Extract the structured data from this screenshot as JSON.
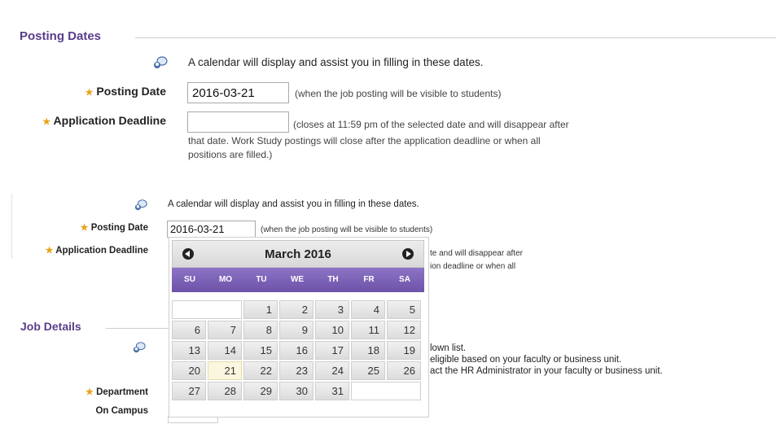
{
  "section1": {
    "title": "Posting Dates",
    "help_text": "A calendar will display and assist you in filling in these dates.",
    "posting_date_label": "Posting Date",
    "posting_date_value": "2016-03-21",
    "posting_date_hint": "(when the job posting will be visible to students)",
    "deadline_label": "Application Deadline",
    "deadline_value": "",
    "deadline_hint_line1": "(closes at 11:59 pm of the selected date and will disappear after",
    "deadline_hint_line2": "that date. Work Study postings will close after the application deadline or when all",
    "deadline_hint_line3": "positions are filled.)"
  },
  "section2": {
    "help_text": "A calendar will display and assist you in filling in these dates.",
    "posting_date_label": "Posting Date",
    "posting_date_value": "2016-03-21",
    "posting_date_hint": "(when the job posting will be visible to students)",
    "deadline_label": "Application Deadline",
    "deadline_hint_frag1": "te and will disappear after",
    "deadline_hint_frag2": "ion deadline or when all"
  },
  "job_details": {
    "title": "Job Details",
    "info_frag1": "lown list.",
    "info_frag2": "eligible based on your faculty or business unit.",
    "info_frag3": "act the HR Administrator in your faculty or business unit.",
    "department_label": "Department",
    "on_campus_label": "On Campus"
  },
  "datepicker": {
    "title": "March 2016",
    "weekdays": [
      "SU",
      "MO",
      "TU",
      "WE",
      "TH",
      "FR",
      "SA"
    ],
    "selected_day": 21,
    "weeks": [
      [
        "",
        "",
        "1",
        "2",
        "3",
        "4",
        "5"
      ],
      [
        "6",
        "7",
        "8",
        "9",
        "10",
        "11",
        "12"
      ],
      [
        "13",
        "14",
        "15",
        "16",
        "17",
        "18",
        "19"
      ],
      [
        "20",
        "21",
        "22",
        "23",
        "24",
        "25",
        "26"
      ],
      [
        "27",
        "28",
        "29",
        "30",
        "31",
        "",
        ""
      ]
    ]
  },
  "colors": {
    "legend": "#5a3d8a",
    "accent": "#7a5fb6",
    "star": "#e8a317"
  },
  "icons": [
    "help-bubble-icon",
    "required-star-icon",
    "prev-month-icon",
    "next-month-icon"
  ]
}
